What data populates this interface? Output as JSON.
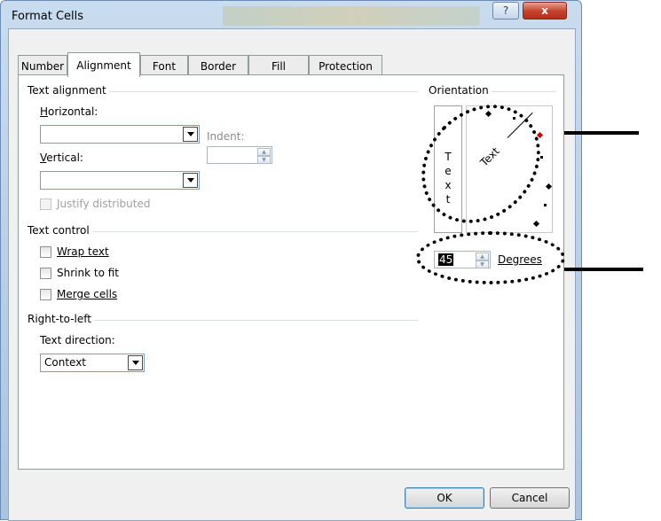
{
  "dialog": {
    "title": "Format Cells",
    "help_label": "?",
    "close_label": "x"
  },
  "tabs": [
    {
      "label": "Number"
    },
    {
      "label": "Alignment",
      "active": true
    },
    {
      "label": "Font"
    },
    {
      "label": "Border"
    },
    {
      "label": "Fill"
    },
    {
      "label": "Protection"
    }
  ],
  "text_alignment": {
    "group_label": "Text alignment",
    "horizontal_label": "Horizontal:",
    "horizontal_value": "",
    "vertical_label": "Vertical:",
    "vertical_value": "",
    "indent_label": "Indent:",
    "indent_value": "",
    "justify_distributed_label": "Justify distributed"
  },
  "text_control": {
    "group_label": "Text control",
    "wrap_text": "Wrap text",
    "shrink_to_fit": "Shrink to fit",
    "merge_cells": "Merge cells"
  },
  "right_to_left": {
    "group_label": "Right-to-left",
    "text_direction_label": "Text direction:",
    "text_direction_value": "Context"
  },
  "orientation": {
    "group_label": "Orientation",
    "vertical_text": [
      "T",
      "e",
      "x",
      "t"
    ],
    "rotated_text": "Text",
    "degrees_value": "45",
    "degrees_label": "Degrees",
    "degrees_angle": 45
  },
  "buttons": {
    "ok": "OK",
    "cancel": "Cancel"
  },
  "colors": {
    "marker": "#cc0000",
    "accent": "#3c7fb1"
  }
}
